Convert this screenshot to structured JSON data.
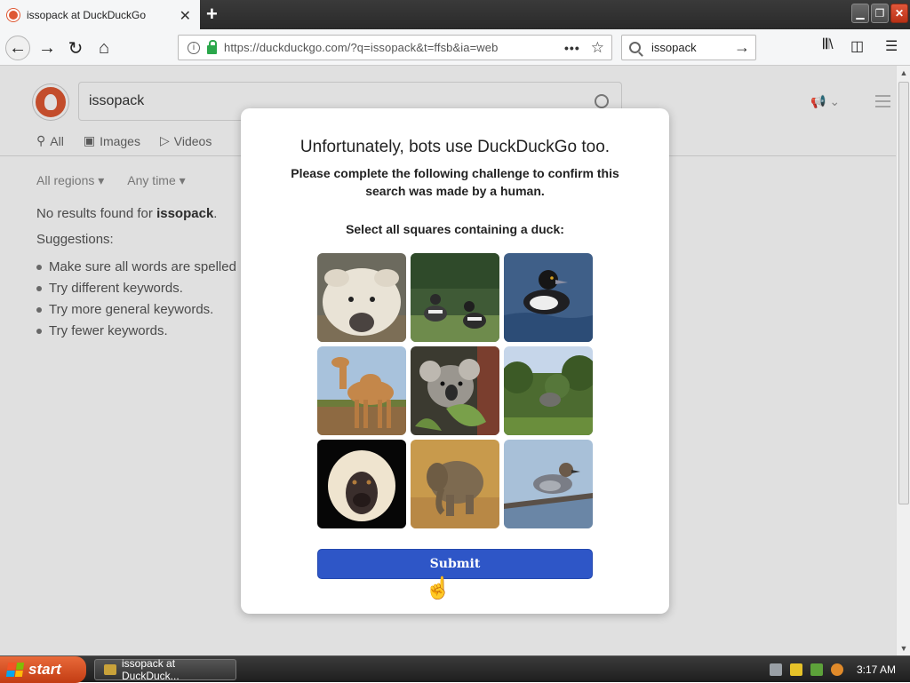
{
  "browser": {
    "tab_title": "issopack at DuckDuckGo",
    "url": "https://duckduckgo.com/?q=issopack&t=ffsb&ia=web",
    "search_value": "issopack"
  },
  "ddg": {
    "query": "issopack",
    "tabs": [
      "All",
      "Images",
      "Videos"
    ],
    "filters": [
      "All regions ▾",
      "Any time ▾"
    ],
    "no_results_prefix": "No results found for ",
    "no_results_query": "issopack",
    "no_results_suffix": ".",
    "suggestions_label": "Suggestions:",
    "suggestions": [
      "Make sure all words are spelled",
      "Try different keywords.",
      "Try more general keywords.",
      "Try fewer keywords."
    ]
  },
  "modal": {
    "title": "Unfortunately, bots use DuckDuckGo too.",
    "subtitle": "Please complete the following challenge to confirm this search was made by a human.",
    "prompt": "Select all squares containing a duck:",
    "submit_label": "Submit",
    "tiles": [
      "pig",
      "ducks",
      "duck",
      "camel",
      "koala",
      "elephant",
      "monkey",
      "elephant",
      "duck"
    ]
  },
  "taskbar": {
    "start_label": "start",
    "task_label": "issopack at DuckDuck...",
    "clock": "3:17 AM"
  },
  "colors": {
    "ddg_orange": "#de5833",
    "submit_blue": "#2e56c7",
    "lock_green": "#2ba74b"
  }
}
